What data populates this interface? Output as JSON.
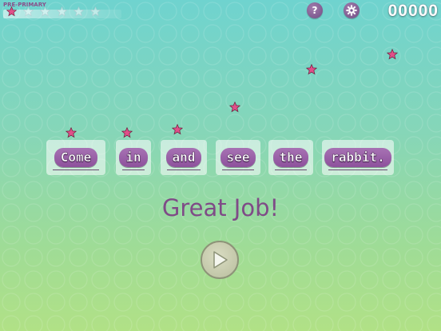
{
  "level": {
    "label": "PRE-PRIMARY",
    "stars_earned": 1,
    "stars_total": 6
  },
  "header": {
    "help_label": "?",
    "score": "00000"
  },
  "sentence": {
    "words": [
      "Come",
      "in",
      "and",
      "see",
      "the",
      "rabbit."
    ]
  },
  "feedback": {
    "message": "Great Job!"
  },
  "colors": {
    "accent_purple": "#9a63a8",
    "star_pink": "#e0508a"
  }
}
